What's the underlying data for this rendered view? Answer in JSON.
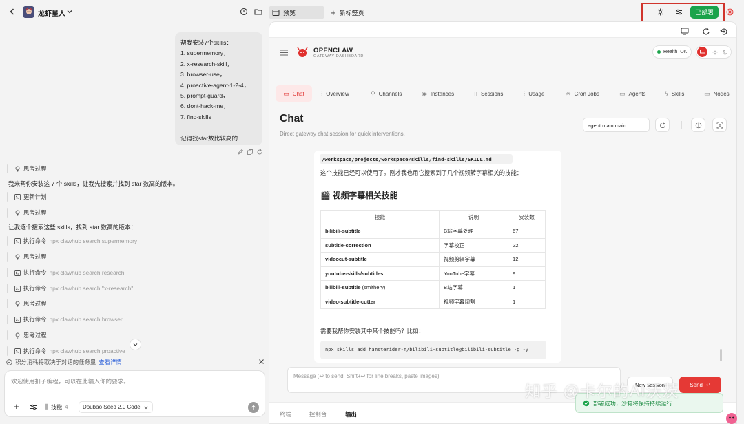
{
  "topbar": {
    "project_name": "龙虾星人",
    "preview_tab": "预览",
    "new_tab": "新标签页",
    "deployed_label": "已部署"
  },
  "left": {
    "user_message_lines": [
      "帮我安装7个skills：",
      "1. supermemory，",
      "2. x-research-skill，",
      "3. browser-use，",
      "4. proactive-agent-1-2-4，",
      "5. prompt-guard，",
      "6. dont-hack-me，",
      "7. find-skills",
      "",
      "记得找star数比较高的"
    ],
    "thinking": "思考过程",
    "para1": "我来帮你安装这 7 个 skills，让我先搜索并找到 star 数高的版本。",
    "update_plan": "更新计划",
    "para2": "让我逐个搜索这些 skills，找到 star 数高的版本：",
    "exec_label": "执行命令",
    "cmds": [
      "npx clawhub search supermemory",
      "npx clawhub search research",
      "npx clawhub search \"x-research\"",
      "npx clawhub search browser",
      "npx clawhub search proactive"
    ],
    "notice": "积分消耗将取决于对话的任务量",
    "notice_link": "查看详情",
    "input_placeholder": "欢迎使用扣子编程，可以在此输入你的要求。",
    "skills_label": "技能",
    "skills_count": "4",
    "model_label": "Doubao Seed 2.0 Code"
  },
  "right": {
    "brand": "OPENCLAW",
    "brand_sub": "GATEWAY DASHBOARD",
    "health": "Health",
    "health_status": "OK",
    "tabs": [
      "Chat",
      "Overview",
      "Channels",
      "Instances",
      "Sessions",
      "Usage",
      "Cron Jobs",
      "Agents",
      "Skills",
      "Nodes"
    ],
    "page_title": "Chat",
    "page_subtitle": "Direct gateway chat session for quick interventions.",
    "session_select": "agent:main:main",
    "path": "/workspace/projects/workspace/skills/find-skills/SKILL.md",
    "msg1": "这个技能已经可以使用了。刚才我也用它搜索到了几个视频转字幕相关的技能：",
    "section_title": "🎬 视频字幕相关技能",
    "table_headers": [
      "技能",
      "说明",
      "安装数"
    ],
    "table_rows": [
      {
        "name": "bilibili-subtitle",
        "suffix": "",
        "desc": "B站字幕处理",
        "count": "67"
      },
      {
        "name": "subtitle-correction",
        "suffix": "",
        "desc": "字幕校正",
        "count": "22"
      },
      {
        "name": "videocut-subtitle",
        "suffix": "",
        "desc": "视频剪辑字幕",
        "count": "12"
      },
      {
        "name": "youtube-skills/subtitles",
        "suffix": "",
        "desc": "YouTube字幕",
        "count": "9"
      },
      {
        "name": "bilibili-subtitle",
        "suffix": " (smithery)",
        "desc": "B站字幕",
        "count": "1"
      },
      {
        "name": "video-subtitle-cutter",
        "suffix": "",
        "desc": "视频字幕切割",
        "count": "1"
      }
    ],
    "msg2": "需要我帮你安装其中某个技能吗？比如：",
    "code": "npx skills add hamsterider-m/bilibili-subtitle@bilibili-subtitle -g -y",
    "message_placeholder": "Message (↩ to send, Shift+↩ for line breaks, paste images)",
    "new_session": "New session",
    "send": "Send",
    "bottom_tabs": [
      "终端",
      "控制台",
      "输出"
    ],
    "toast": "部署成功，沙箱将保持持续运行",
    "watermark": "知乎 @卡尔的AI沃茨"
  },
  "colors": {
    "accent_green": "#1aa34a",
    "accent_red": "#e53935",
    "highlight_box": "#d0342c",
    "tab_active_bg": "#fde8e8"
  }
}
